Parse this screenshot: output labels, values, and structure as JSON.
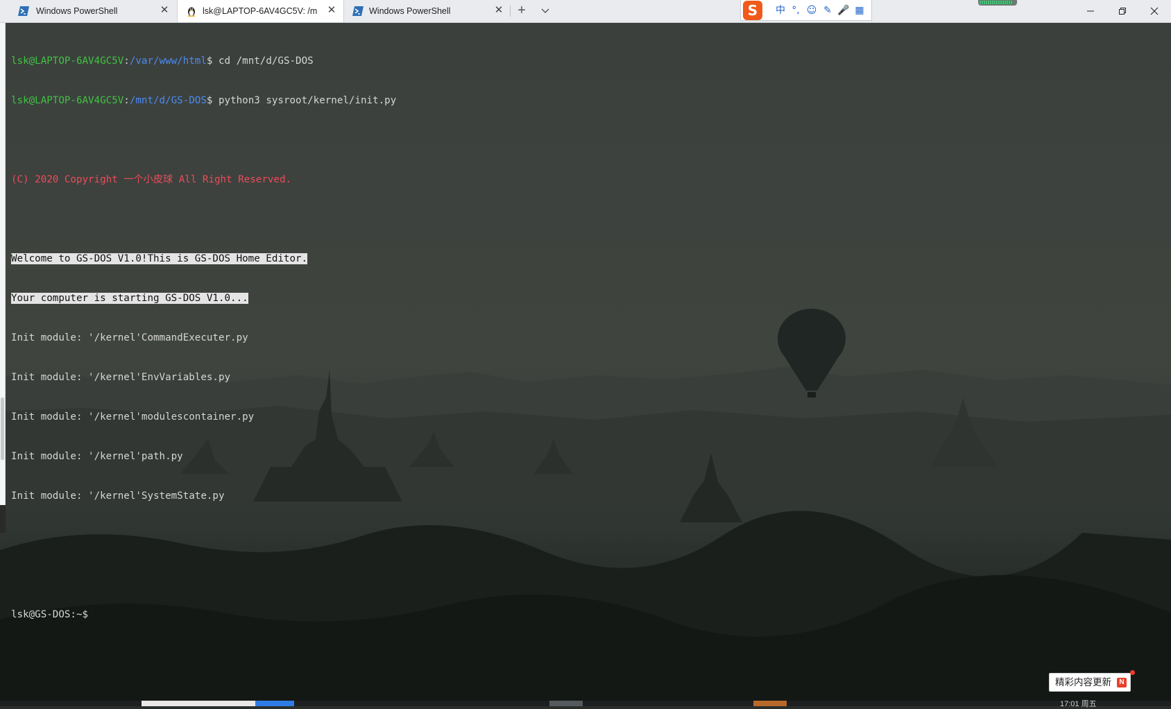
{
  "tabs": [
    {
      "label": "Windows PowerShell",
      "icon": "powershell-icon",
      "active": false
    },
    {
      "label": "lsk@LAPTOP-6AV4GC5V: /mnt/d",
      "icon": "linux-penguin-icon",
      "active": true
    },
    {
      "label": "Windows PowerShell",
      "icon": "powershell-icon",
      "active": false
    }
  ],
  "tabbar": {
    "new_tab": "+",
    "close": "✕"
  },
  "ime": {
    "logo": "S",
    "mode": "中",
    "punct": "°,",
    "emoji": "☺",
    "skin": "✎",
    "voice": "🎤",
    "toolbox": "▦"
  },
  "net_meter": {
    "level": 0.9
  },
  "terminal": {
    "line1": {
      "user": "lsk@LAPTOP-6AV4GC5V",
      "sep": ":",
      "path": "/var/www/html",
      "prompt": "$ ",
      "cmd": "cd /mnt/d/GS-DOS"
    },
    "line2": {
      "user": "lsk@LAPTOP-6AV4GC5V",
      "sep": ":",
      "path": "/mnt/d/GS-DOS",
      "prompt": "$ ",
      "cmd": "python3 sysroot/kernel/init.py"
    },
    "copyright": "(C) 2020 Copyright 一个小皮球 All Right Reserved.",
    "welcome": "Welcome to GS-DOS V1.0!This is GS-DOS Home Editor.",
    "starting": "Your computer is starting GS-DOS V1.0...",
    "modules": [
      "Init module: '/kernel'CommandExecuter.py",
      "Init module: '/kernel'EnvVariables.py",
      "Init module: '/kernel'modulescontainer.py",
      "Init module: '/kernel'path.py",
      "Init module: '/kernel'SystemState.py"
    ],
    "shell_prompt": "lsk@GS-DOS:~$"
  },
  "popup": {
    "text": "精彩内容更新",
    "badge": "N"
  },
  "taskbar": {
    "clock": "17:01 周五"
  },
  "colors": {
    "prompt_user": "#3fc43f",
    "prompt_path": "#4b8bf0",
    "copyright": "#ee4b5a",
    "terminal_text": "#d6d6d6"
  }
}
